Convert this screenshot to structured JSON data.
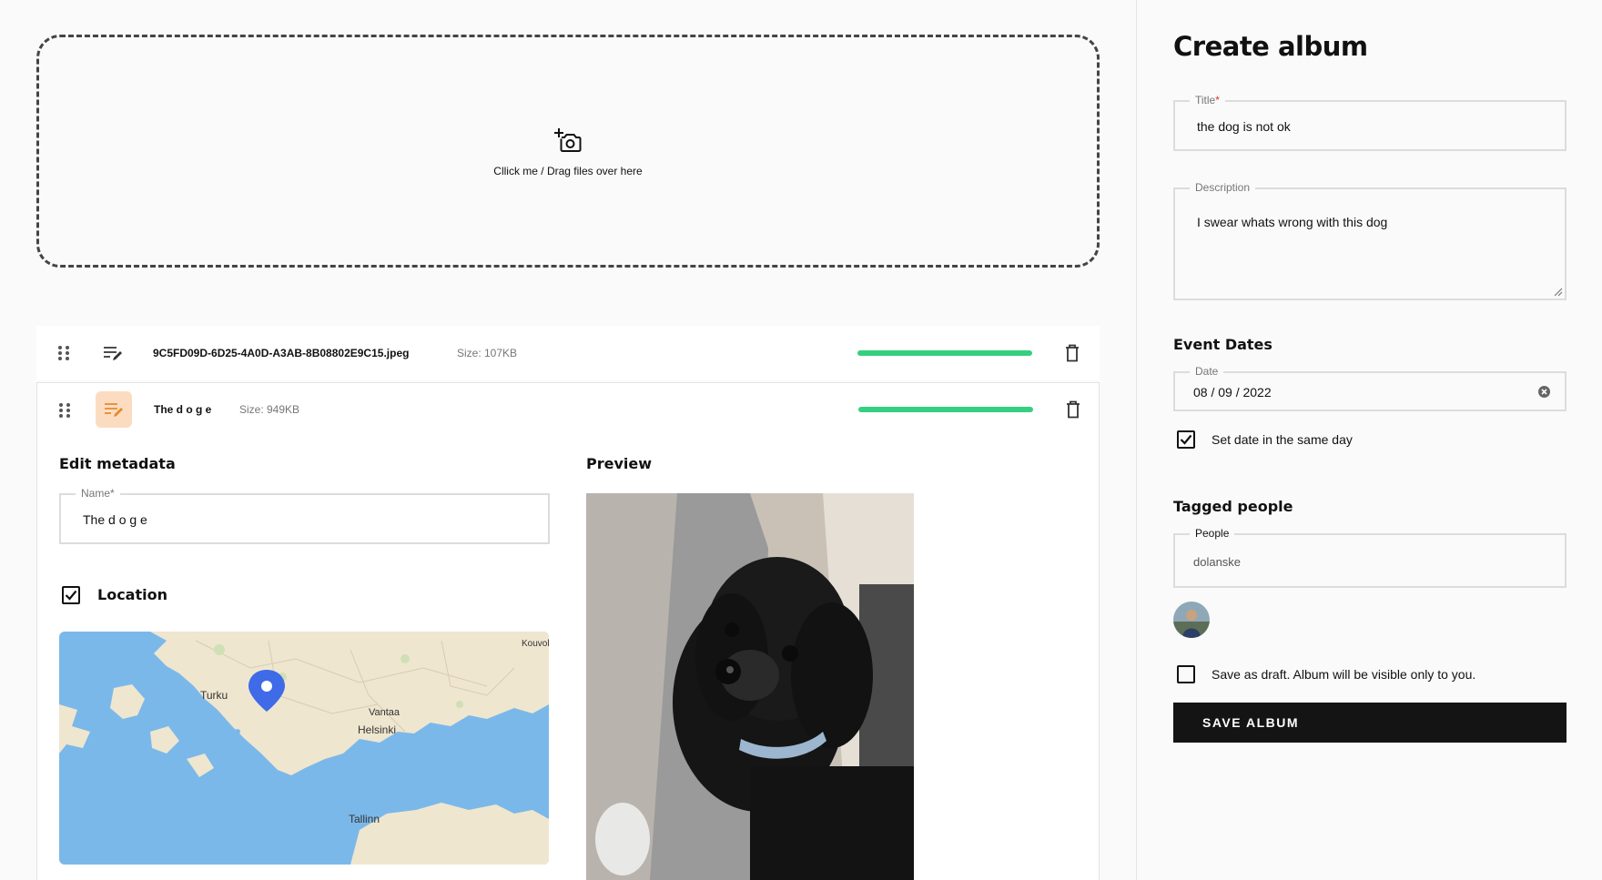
{
  "dropzone": {
    "text": "Cllick me / Drag files over here",
    "icon": "add-photo-icon"
  },
  "files": [
    {
      "name": "9C5FD09D-6D25-4A0D-A3AB-8B08802E9C15.jpeg",
      "size": "Size: 107KB",
      "progress": 1.0
    },
    {
      "name": "The d o g e",
      "size": "Size: 949KB",
      "progress": 1.0
    }
  ],
  "metadata": {
    "title": "Edit metadata",
    "name_label": "Name*",
    "name_value": "The d o g e",
    "location_label": "Location",
    "location_checked": true,
    "preview_title": "Preview",
    "map_labels": {
      "turku": "Turku",
      "vantaa": "Vantaa",
      "helsinki": "Helsinki",
      "tallinn": "Tallinn",
      "kouvola": "Kouvol"
    }
  },
  "album": {
    "heading": "Create album",
    "title_label": "Title",
    "title_required": "*",
    "title_value": "the dog is not ok",
    "description_label": "Description",
    "description_value": "I swear whats wrong with this dog",
    "event_dates_heading": "Event Dates",
    "date_label": "Date",
    "date_value": "08 / 09 / 2022",
    "same_day_label": "Set date in the same day",
    "same_day_checked": true,
    "tagged_heading": "Tagged people",
    "people_label": "People",
    "people_value": "dolanske",
    "draft_label": "Save as draft. Album will be visible only to you.",
    "draft_checked": false,
    "save_label": "SAVE ALBUM"
  },
  "colors": {
    "accent_progress": "#35d07f",
    "edit_active_bg": "#fbdcc1",
    "edit_active_icon": "#e58a2f",
    "button_bg": "#141414",
    "map_water": "#7bb8ea",
    "map_land": "#efe6cf",
    "pin": "#3f6ae8"
  }
}
